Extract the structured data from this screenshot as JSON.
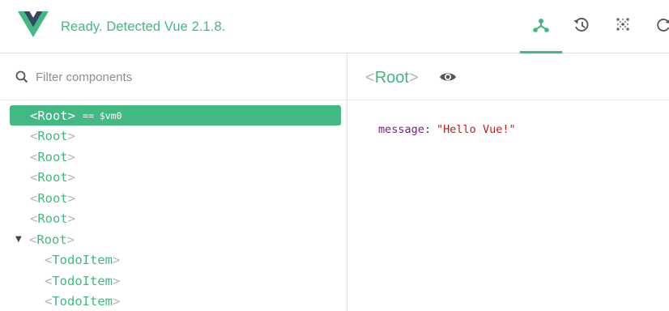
{
  "header": {
    "status_text": "Ready. Detected Vue 2.1.8.",
    "logo": "vue-logo",
    "tabs": [
      {
        "icon": "components-icon",
        "active": true
      },
      {
        "icon": "history-icon",
        "active": false
      },
      {
        "icon": "events-icon",
        "active": false
      },
      {
        "icon": "refresh-icon",
        "active": false
      }
    ]
  },
  "search": {
    "placeholder": "Filter components",
    "value": ""
  },
  "tree": {
    "open_bracket": "<",
    "close_bracket": ">",
    "vm_ref": "== $vm0",
    "items": [
      {
        "name": "Root",
        "selected": true
      },
      {
        "name": "Root"
      },
      {
        "name": "Root"
      },
      {
        "name": "Root"
      },
      {
        "name": "Root"
      },
      {
        "name": "Root"
      },
      {
        "name": "Root",
        "expanded": true,
        "arrow": "▼"
      },
      {
        "name": "TodoItem"
      },
      {
        "name": "TodoItem"
      },
      {
        "name": "TodoItem"
      }
    ]
  },
  "inspector": {
    "component_name": "Root",
    "state": {
      "key": "message",
      "colon": ":",
      "value": "\"Hello Vue!\""
    }
  },
  "colors": {
    "accent": "#42b983",
    "bracket": "#b5b5b5",
    "state_key": "#881391",
    "state_string": "#c41a16"
  }
}
